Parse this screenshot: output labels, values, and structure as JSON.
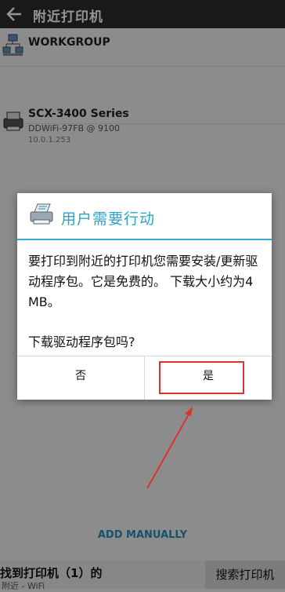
{
  "header": {
    "title": "附近打印机"
  },
  "printers": [
    {
      "name": "WORKGROUP",
      "icon": "network-icon"
    },
    {
      "name": "SCX-3400 Series",
      "subtitle": "DDWiFi-97FB @ 9100",
      "address": "10.0.1.253",
      "icon": "printer-icon"
    }
  ],
  "add_manually": "ADD MANUALLY",
  "bottom": {
    "found": "找到打印机（1）的",
    "found_sub": "附近 - WiFi",
    "search_button": "搜索打印机"
  },
  "dialog": {
    "title": "用户需要行动",
    "message": "要打印到附近的打印机您需要安装/更新驱动程序包。它是免费的。 下载大小约为4 MB。",
    "question": "下载驱动程序包吗?",
    "no_button": "否",
    "yes_button": "是"
  },
  "colors": {
    "accent": "#34aacd",
    "annotation": "#d9342f"
  }
}
